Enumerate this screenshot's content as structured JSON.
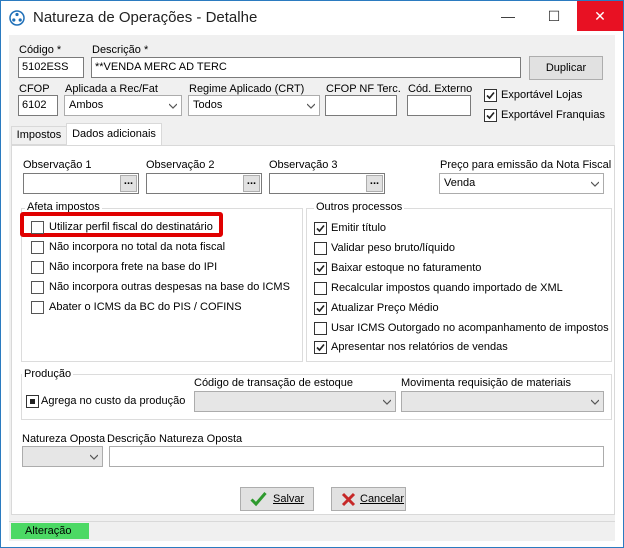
{
  "window": {
    "title": "Natureza de Operações - Detalhe"
  },
  "titlebar_buttons": {
    "minimize": "—",
    "maximize": "☐",
    "close": "✕",
    "close_color": "#e81123"
  },
  "header": {
    "codigo_label": "Código *",
    "codigo_value": "5102ESS",
    "descricao_label": "Descrição *",
    "descricao_value": "**VENDA MERC AD TERC",
    "duplicar_label": "Duplicar",
    "cfop_label": "CFOP",
    "cfop_value": "6102",
    "aplicada_label": "Aplicada a Rec/Fat",
    "aplicada_value": "Ambos",
    "regime_label": "Regime Aplicado (CRT)",
    "regime_value": "Todos",
    "cfop_nf_label": "CFOP NF Terc.",
    "cfop_nf_value": "",
    "cod_externo_label": "Cód. Externo",
    "cod_externo_value": "",
    "exportavel_lojas_label": "Exportável Lojas",
    "exportavel_lojas_checked": true,
    "exportavel_franquias_label": "Exportável Franquias",
    "exportavel_franquias_checked": true
  },
  "tabs": [
    {
      "label": "Impostos",
      "active": false
    },
    {
      "label": "Dados adicionais",
      "active": true
    }
  ],
  "observacoes": {
    "obs1_label": "Observação 1",
    "obs2_label": "Observação 2",
    "obs3_label": "Observação 3",
    "ellipsis": "...",
    "preco_label": "Preço para emissão da Nota Fiscal",
    "preco_value": "Venda"
  },
  "afeta_impostos": {
    "title": "Afeta impostos",
    "items": [
      {
        "label": "Utilizar perfil fiscal do destinatário",
        "checked": false
      },
      {
        "label": "Não incorpora no total da nota fiscal",
        "checked": false
      },
      {
        "label": "Não incorpora frete na base do IPI",
        "checked": false
      },
      {
        "label": "Não incorpora outras despesas na base do ICMS",
        "checked": false
      },
      {
        "label": "Abater o ICMS da BC do PIS / COFINS",
        "checked": false
      }
    ],
    "highlight_color": "#e00000"
  },
  "outros_processos": {
    "title": "Outros processos",
    "items": [
      {
        "label": "Emitir título",
        "checked": true
      },
      {
        "label": "Validar peso bruto/líquido",
        "checked": false
      },
      {
        "label": "Baixar estoque no faturamento",
        "checked": true
      },
      {
        "label": "Recalcular impostos quando importado de XML",
        "checked": false
      },
      {
        "label": "Atualizar Preço Médio",
        "checked": true
      },
      {
        "label": "Usar ICMS Outorgado no acompanhamento de impostos",
        "checked": false
      },
      {
        "label": "Apresentar nos relatórios de vendas",
        "checked": true
      }
    ]
  },
  "producao": {
    "title": "Produção",
    "agrega_label": "Agrega no custo da produção",
    "codigo_transacao_label": "Código de transação de estoque",
    "codigo_transacao_value": "",
    "movimenta_label": "Movimenta requisição de materiais",
    "movimenta_value": ""
  },
  "natureza_oposta": {
    "label": "Natureza Oposta",
    "descricao_label": "Descrição Natureza Oposta",
    "value": "",
    "descricao_value": ""
  },
  "footer": {
    "salvar_label": "Salvar",
    "cancelar_label": "Cancelar",
    "status_text": "Alteração",
    "status_color": "#4cd964"
  }
}
